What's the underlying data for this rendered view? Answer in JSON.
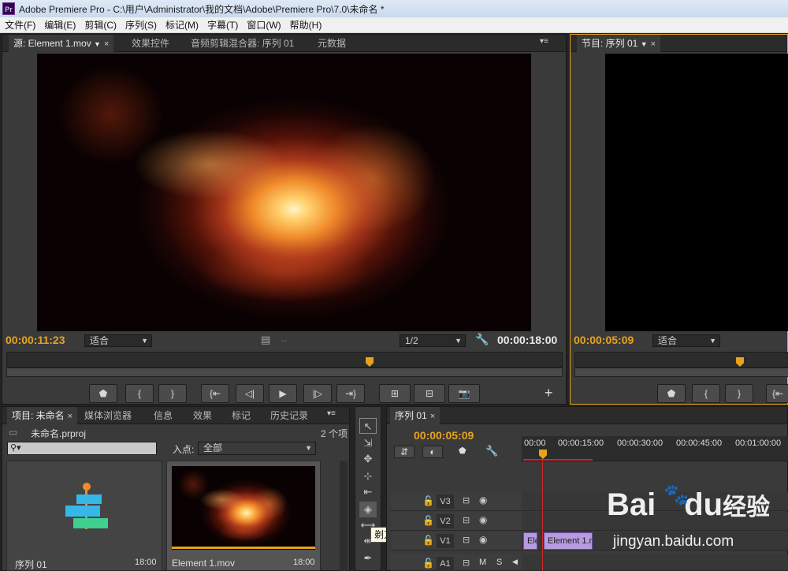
{
  "window": {
    "title": "Adobe Premiere Pro - C:\\用户\\Administrator\\我的文档\\Adobe\\Premiere Pro\\7.0\\未命名 *",
    "app_icon": "Pr"
  },
  "menu": [
    "文件(F)",
    "编辑(E)",
    "剪辑(C)",
    "序列(S)",
    "标记(M)",
    "字幕(T)",
    "窗口(W)",
    "帮助(H)"
  ],
  "source_panel": {
    "tabs": [
      "源: Element 1.mov",
      "效果控件",
      "音频剪辑混合器: 序列 01",
      "元数据"
    ],
    "timecode_left": "00:00:11:23",
    "fit": "适合",
    "resolution": "1/2",
    "timecode_right": "00:00:18:00",
    "buttons": [
      "⬟",
      "{",
      "}",
      "{⇤",
      "◁|",
      "▶",
      "|▷",
      "⇥}",
      "⊞",
      "⊟",
      "📷"
    ]
  },
  "program_panel": {
    "tab": "节目: 序列 01",
    "timecode": "00:00:05:09",
    "fit": "适合",
    "buttons": [
      "⬟",
      "{",
      "}",
      "{⇤"
    ]
  },
  "project_panel": {
    "tabs": [
      "项目: 未命名",
      "媒体浏览器",
      "信息",
      "效果",
      "标记",
      "历史记录"
    ],
    "project_file": "未命名.prproj",
    "item_count": "2 个项",
    "search_placeholder": "",
    "in_point_label": "入点:",
    "in_point_value": "全部",
    "items": [
      {
        "name": "序列 01",
        "duration": "18:00"
      },
      {
        "name": "Element 1.mov",
        "duration": "18:00"
      }
    ]
  },
  "tools": {
    "tooltip": "剃刀工具 (C)"
  },
  "timeline": {
    "tab": "序列 01",
    "timecode": "00:00:05:09",
    "ruler_labels": [
      "00:00",
      "00:00:15:00",
      "00:00:30:00",
      "00:00:45:00",
      "00:01:00:00"
    ],
    "tracks": [
      "V3",
      "V2",
      "V1",
      "A1"
    ],
    "clips": [
      "Ele",
      "Element 1.m"
    ],
    "a1_buttons": [
      "M",
      "S"
    ]
  },
  "watermark": {
    "brand": "Bai",
    "brand2": "du",
    "brand_cn": "经验",
    "url": "jingyan.baidu.com"
  }
}
